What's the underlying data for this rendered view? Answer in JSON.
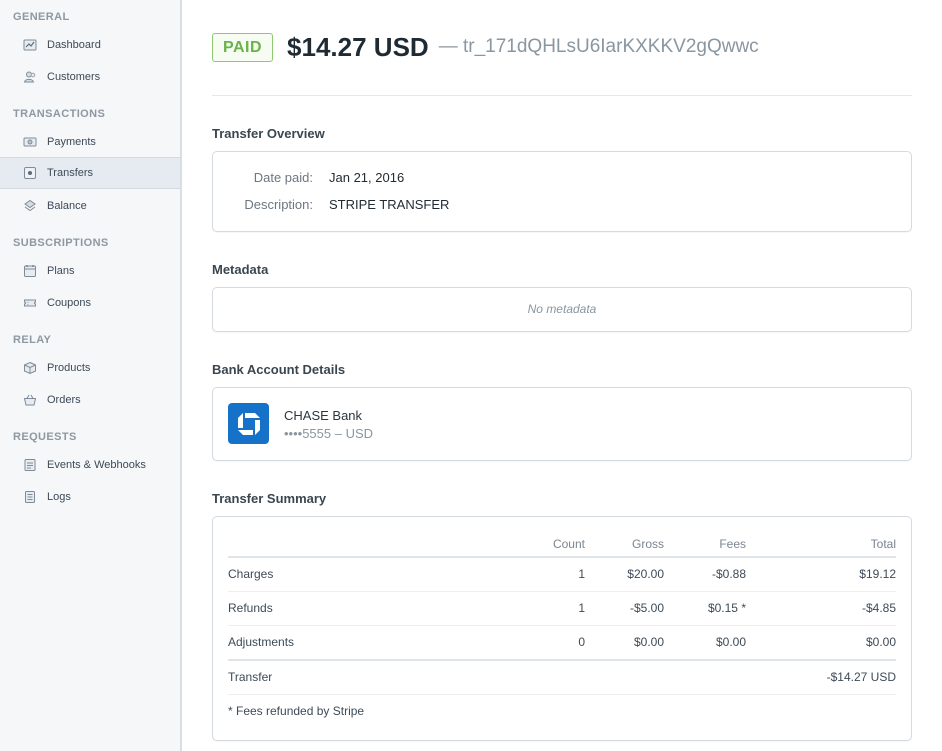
{
  "sidebar": {
    "sections": [
      {
        "heading": "GENERAL",
        "items": [
          {
            "label": "Dashboard",
            "icon": "dashboard-icon"
          },
          {
            "label": "Customers",
            "icon": "customers-icon"
          }
        ]
      },
      {
        "heading": "TRANSACTIONS",
        "items": [
          {
            "label": "Payments",
            "icon": "payments-icon"
          },
          {
            "label": "Transfers",
            "icon": "transfers-icon",
            "active": true
          },
          {
            "label": "Balance",
            "icon": "balance-icon"
          }
        ]
      },
      {
        "heading": "SUBSCRIPTIONS",
        "items": [
          {
            "label": "Plans",
            "icon": "plans-icon"
          },
          {
            "label": "Coupons",
            "icon": "coupons-icon"
          }
        ]
      },
      {
        "heading": "RELAY",
        "items": [
          {
            "label": "Products",
            "icon": "products-icon"
          },
          {
            "label": "Orders",
            "icon": "orders-icon"
          }
        ]
      },
      {
        "heading": "REQUESTS",
        "items": [
          {
            "label": "Events & Webhooks",
            "icon": "events-icon"
          },
          {
            "label": "Logs",
            "icon": "logs-icon"
          }
        ]
      }
    ]
  },
  "header": {
    "status": "PAID",
    "amount": "$14.27 USD",
    "transfer_id": "— tr_171dQHLsU6IarKXKKV2gQwwc"
  },
  "overview": {
    "title": "Transfer Overview",
    "date_label": "Date paid:",
    "date_value": "Jan 21, 2016",
    "desc_label": "Description:",
    "desc_value": "STRIPE TRANSFER"
  },
  "metadata": {
    "title": "Metadata",
    "empty_text": "No metadata"
  },
  "bank": {
    "title": "Bank Account Details",
    "name": "CHASE Bank",
    "account": "••••5555 – USD",
    "logo_icon": "chase-logo-icon"
  },
  "summary": {
    "title": "Transfer Summary",
    "headers": {
      "count": "Count",
      "gross": "Gross",
      "fees": "Fees",
      "total": "Total"
    },
    "rows": [
      {
        "label": "Charges",
        "count": "1",
        "gross": "$20.00",
        "fees": "-$0.88",
        "total": "$19.12"
      },
      {
        "label": "Refunds",
        "count": "1",
        "gross": "-$5.00",
        "fees": "$0.15 *",
        "total": "-$4.85"
      },
      {
        "label": "Adjustments",
        "count": "0",
        "gross": "$0.00",
        "fees": "$0.00",
        "total": "$0.00"
      }
    ],
    "transfer_label": "Transfer",
    "transfer_total": "-$14.27 USD",
    "footnote": "* Fees refunded by Stripe"
  },
  "colors": {
    "paid_green": "#6ab24a",
    "chase_blue": "#1672c8",
    "sidebar_bg": "#f5f7f9"
  }
}
